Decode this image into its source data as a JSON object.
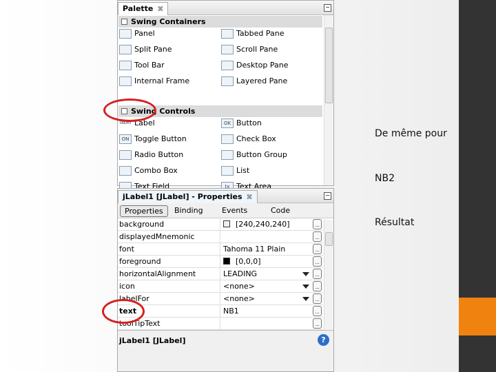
{
  "palette": {
    "title": "Palette",
    "close": "⌘",
    "min": "−",
    "categories": [
      "Swing Containers",
      "Swing Controls"
    ],
    "containers": [
      [
        "Panel",
        "Tabbed Pane"
      ],
      [
        "Split Pane",
        "Scroll Pane"
      ],
      [
        "Tool Bar",
        "Desktop Pane"
      ],
      [
        "Internal Frame",
        "Layered Pane"
      ]
    ],
    "controls": [
      [
        "Label",
        "Button"
      ],
      [
        "Toggle Button",
        "Check Box"
      ],
      [
        "Radio Button",
        "Button Group"
      ],
      [
        "Combo Box",
        "List"
      ],
      [
        "Text Field",
        "Text Area"
      ]
    ],
    "icon_text": {
      "label": "label",
      "ok": "OK",
      "on": "ON",
      "tx": "tx"
    }
  },
  "properties": {
    "title": "jLabel1 [JLabel] - Properties",
    "close": "⌘",
    "tabs": [
      "Properties",
      "Binding",
      "Events",
      "Code"
    ],
    "rows": [
      {
        "name": "background",
        "value": "[240,240,240]",
        "swatch": "#f0f0f0"
      },
      {
        "name": "displayedMnemonic",
        "value": ""
      },
      {
        "name": "font",
        "value": "Tahoma 11 Plain"
      },
      {
        "name": "foreground",
        "value": "[0,0,0]",
        "swatch": "#000000"
      },
      {
        "name": "horizontalAlignment",
        "value": "LEADING",
        "dropdown": true
      },
      {
        "name": "icon",
        "value": "<none>",
        "dropdown": true
      },
      {
        "name": "labelFor",
        "value": "<none>",
        "dropdown": true
      },
      {
        "name": "text",
        "value": "NB1",
        "bold": true
      },
      {
        "name": "toolTipText",
        "value": ""
      }
    ],
    "button_label": "...",
    "footer": "jLabel1 [JLabel]",
    "help": "?"
  },
  "notes": [
    "De même pour",
    "NB2",
    "Résultat"
  ],
  "colors": {
    "accent": "#f0820f",
    "sidebar": "#333333",
    "highlight_ring": "#d61f1f"
  }
}
